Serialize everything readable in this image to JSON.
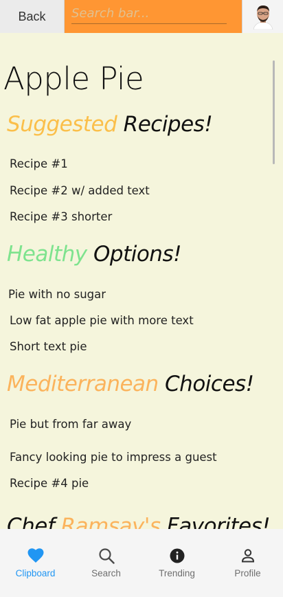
{
  "header": {
    "back_label": "Back",
    "search_placeholder": "Search bar..."
  },
  "page_title": "Apple Pie",
  "sections": [
    {
      "accent": "Suggested",
      "rest": " Recipes!",
      "accent_color": "#fbbf4a",
      "items": [
        "Recipe #1",
        "Recipe #2 w/ added text",
        "Recipe #3 shorter"
      ]
    },
    {
      "accent": "Healthy",
      "rest": " Options!",
      "accent_color": "#7ee38e",
      "items": [
        "Pie with no sugar",
        "Low fat apple pie with more text",
        "Short text pie"
      ]
    },
    {
      "accent": "Mediterranean",
      "rest": " Choices!",
      "accent_color": "#fbb35c",
      "items": [
        "Pie but from far away",
        "Fancy looking pie to impress a guest",
        "Recipe #4 pie"
      ]
    },
    {
      "prefix": "Chef ",
      "accent": "Ramsay's",
      "rest": " Favorites!",
      "accent_color": "#fbb35c"
    }
  ],
  "nav": {
    "items": [
      {
        "label": "Clipboard",
        "icon": "heart-icon",
        "active": true
      },
      {
        "label": "Search",
        "icon": "search-icon",
        "active": false
      },
      {
        "label": "Trending",
        "icon": "info-icon",
        "active": false
      },
      {
        "label": "Profile",
        "icon": "person-icon",
        "active": false
      }
    ],
    "active_color": "#2196f3",
    "inactive_color": "#6e6e6e"
  }
}
